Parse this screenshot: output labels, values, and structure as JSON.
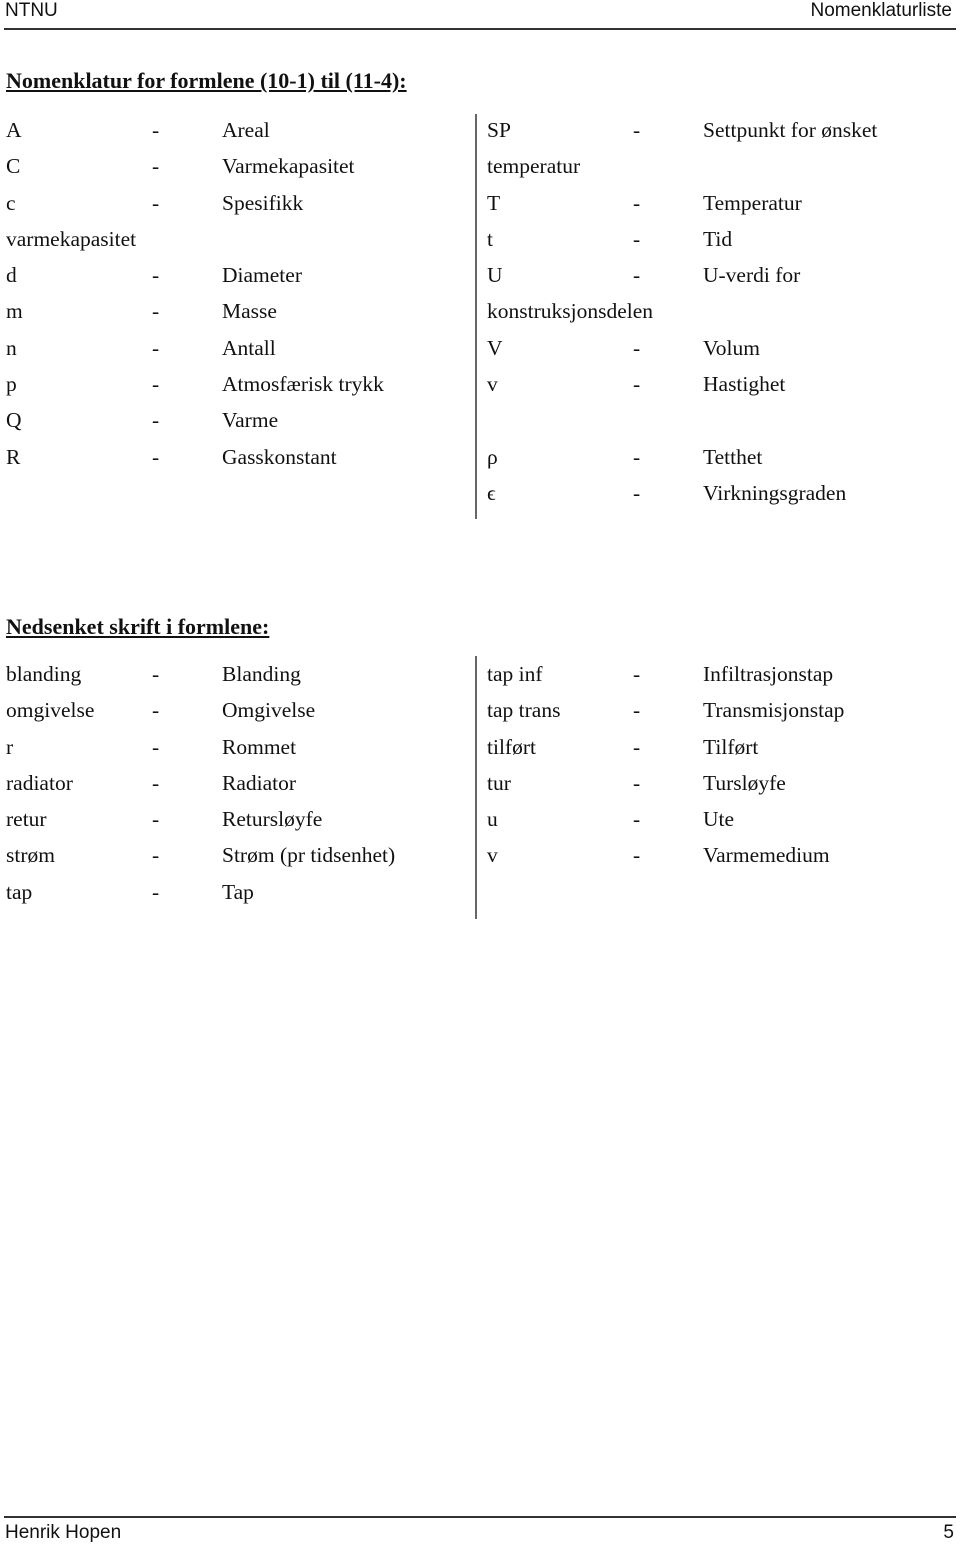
{
  "header": {
    "left": "NTNU",
    "right": "Nomenklaturliste"
  },
  "footer": {
    "author": "Henrik Hopen",
    "page_number": "5"
  },
  "section1": {
    "title": "Nomenklatur for formlene (10-1) til (11-4):",
    "left_rows": [
      {
        "sym": "A",
        "dash": "-",
        "desc": "Areal"
      },
      {
        "sym": "C",
        "dash": "-",
        "desc": "Varmekapasitet"
      },
      {
        "sym": "c",
        "dash": "-",
        "desc": "Spesifikk"
      },
      {
        "sym": "varmekapasitet",
        "dash": "",
        "desc": ""
      },
      {
        "sym": "d",
        "dash": "-",
        "desc": "Diameter"
      },
      {
        "sym": "m",
        "dash": "-",
        "desc": "Masse"
      },
      {
        "sym": "n",
        "dash": "-",
        "desc": "Antall"
      },
      {
        "sym": "p",
        "dash": "-",
        "desc": "Atmosfærisk trykk"
      },
      {
        "sym": "Q",
        "dash": "-",
        "desc": "Varme"
      },
      {
        "sym": "R",
        "dash": "-",
        "desc": "Gasskonstant"
      }
    ],
    "right_rows": [
      {
        "sym": "SP",
        "dash": "-",
        "desc": "Settpunkt for ønsket"
      },
      {
        "sym": "temperatur",
        "dash": "",
        "desc": ""
      },
      {
        "sym": "T",
        "dash": "-",
        "desc": "Temperatur"
      },
      {
        "sym": "t",
        "dash": "-",
        "desc": "Tid"
      },
      {
        "sym": "U",
        "dash": "-",
        "desc": "U-verdi for"
      },
      {
        "sym": "konstruksjonsdelen",
        "dash": "",
        "desc": ""
      },
      {
        "sym": "V",
        "dash": "-",
        "desc": "Volum"
      },
      {
        "sym": "v",
        "dash": "-",
        "desc": "Hastighet"
      },
      {
        "sym": "",
        "dash": "",
        "desc": ""
      },
      {
        "sym": "ρ",
        "dash": "-",
        "desc": "Tetthet"
      },
      {
        "sym": "ϵ",
        "dash": "-",
        "desc": "Virkningsgraden"
      }
    ]
  },
  "section2": {
    "title": "Nedsenket skrift i formlene:",
    "left_rows": [
      {
        "sym": "blanding",
        "dash": "-",
        "desc": "Blanding"
      },
      {
        "sym": "omgivelse",
        "dash": "-",
        "desc": "Omgivelse"
      },
      {
        "sym": "r",
        "dash": "-",
        "desc": "Rommet"
      },
      {
        "sym": "radiator",
        "dash": "-",
        "desc": "Radiator"
      },
      {
        "sym": "retur",
        "dash": "-",
        "desc": "Retursløyfe"
      },
      {
        "sym": "strøm",
        "dash": "-",
        "desc": "Strøm (pr tidsenhet)"
      },
      {
        "sym": "tap",
        "dash": "-",
        "desc": "Tap"
      }
    ],
    "right_rows": [
      {
        "sym": "tap inf",
        "dash": "-",
        "desc": "Infiltrasjonstap"
      },
      {
        "sym": "tap trans",
        "dash": "-",
        "desc": "Transmisjonstap"
      },
      {
        "sym": "tilført",
        "dash": "-",
        "desc": "Tilført"
      },
      {
        "sym": "tur",
        "dash": "-",
        "desc": "Tursløyfe"
      },
      {
        "sym": "u",
        "dash": "-",
        "desc": "Ute"
      },
      {
        "sym": "v",
        "dash": "-",
        "desc": "Varmemedium"
      }
    ]
  }
}
